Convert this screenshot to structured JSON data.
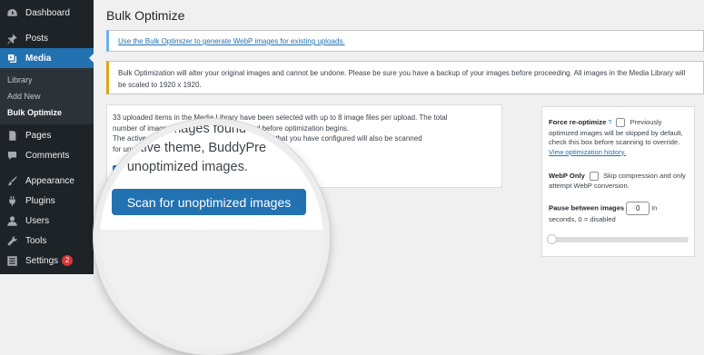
{
  "sidebar": {
    "items": [
      {
        "label": "Dashboard",
        "icon": "dashboard-icon"
      },
      {
        "label": "Posts",
        "icon": "pin-icon"
      },
      {
        "label": "Media",
        "icon": "media-icon"
      },
      {
        "label": "Pages",
        "icon": "page-icon"
      },
      {
        "label": "Comments",
        "icon": "comment-icon"
      },
      {
        "label": "Appearance",
        "icon": "brush-icon"
      },
      {
        "label": "Plugins",
        "icon": "plugin-icon"
      },
      {
        "label": "Users",
        "icon": "user-icon"
      },
      {
        "label": "Tools",
        "icon": "wrench-icon"
      },
      {
        "label": "Settings",
        "icon": "settings-icon",
        "badge": "2"
      }
    ],
    "submenu": [
      "Library",
      "Add New",
      "Bulk Optimize"
    ]
  },
  "page": {
    "title": "Bulk Optimize"
  },
  "notices": {
    "info_link": "Use the Bulk Optimizer to generate WebP images for existing uploads.",
    "warning": "Bulk Optimization will alter your original images and cannot be undone. Please be sure you have a backup of your images before proceeding. All images in the Media Library will be scaled to 1920 x 1920."
  },
  "card": {
    "line1": "33 uploaded items in the Media Library have been selected with up to 8 image files per upload. The total",
    "line2": "number of images found will be displayed and before optimization begins.",
    "line3": "The active theme, BuddyPress album, and folders that you have configured will also be scanned",
    "line4": "for unoptimized images."
  },
  "magnifier": {
    "line1": "r of images found",
    "line2": "active theme, BuddyPre",
    "line3": "r unoptimized images.",
    "line2_prefix": "e",
    "button": "Scan for unoptimized images"
  },
  "settings": {
    "force_label": "Force re-optimize",
    "force_help": "?",
    "force_desc_1": "Previously optimized images will be skipped by default, check this box before scanning to override.",
    "force_link": "View optimization history.",
    "webp_label": "WebP Only",
    "webp_desc": "Skip compression and only attempt WebP conversion.",
    "pause_label": "Pause between images",
    "pause_value": "0",
    "pause_unit": "in",
    "pause_desc": "seconds, 0 = disabled",
    "slider_value": 0
  },
  "colors": {
    "sidebar_bg": "#1d2327",
    "accent": "#2271b1",
    "warning_border": "#dba617",
    "info_border": "#72aee6"
  }
}
